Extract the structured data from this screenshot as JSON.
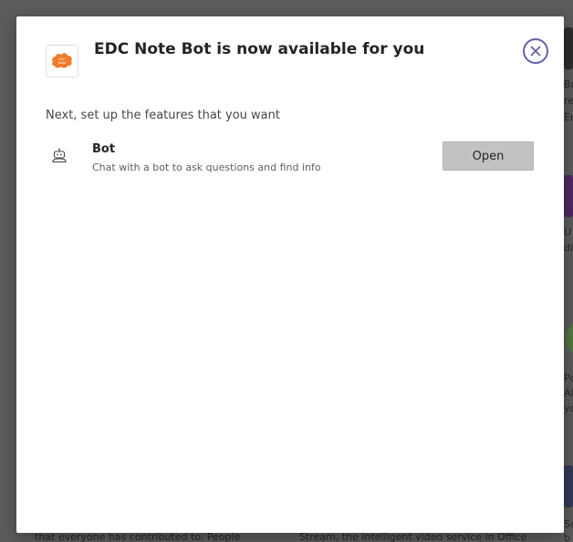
{
  "dialog": {
    "title": "EDC Note Bot is now available for you",
    "logo_icon": "edc-note-bot-logo",
    "close_icon": "close-icon",
    "setup_label": "Next, set up the features that you want",
    "features": [
      {
        "icon": "bot-icon",
        "name": "Bot",
        "description": "Chat with a bot to ask questions and find info",
        "action_label": "Open"
      }
    ]
  },
  "background": {
    "right_edge_fragments": [
      "Br",
      "re",
      "Er",
      "U",
      "di",
      "Pc",
      "Al",
      "yc",
      "Se",
      "b"
    ],
    "bottom_left_text": "that everyone has contributed to. People",
    "bottom_right_text": "Stream, the intelligent video service in Office"
  },
  "colors": {
    "accent": "#6264a7",
    "logo_orange": "#f07a2a",
    "button_bg": "#c2c2c2",
    "overlay": "#5c5c5c"
  }
}
